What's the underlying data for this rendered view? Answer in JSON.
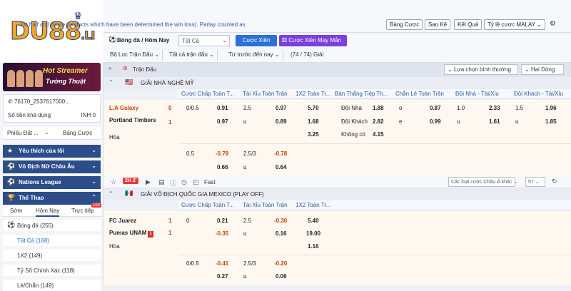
{
  "brand": {
    "logo_text": "DU88",
    "logo_suffix": ".LI",
    "crown_icon": "crown-icon",
    "primary_color": "#2c4d8a",
    "accent_color": "#f5a623"
  },
  "banner": {
    "title": "Hot Streamer",
    "subtitle": "Tướng Thuật"
  },
  "account": {
    "id": "76170_2537617000...",
    "balance_label": "Số tiền khả dụng",
    "balance_value": "INH 0"
  },
  "bet_tabs": {
    "slip": "Phiếu Đặt ...",
    "table": "Bảng Cược"
  },
  "sidebar": {
    "sections": [
      {
        "label": "Yêu thích của tôi",
        "icon": "star-icon"
      },
      {
        "label": "Vô Địch Nữ Châu Âu",
        "icon": "soccer-icon"
      },
      {
        "label": "Nations League",
        "icon": "soccer-icon"
      },
      {
        "label": "Thể Thao",
        "icon": "trophy-icon"
      }
    ],
    "sport_tabs": [
      "Sớm",
      "Hôm Nay",
      "Trực tiếp"
    ],
    "live_count": "103",
    "sport_rows": [
      {
        "label": "Bóng đá",
        "count": "(255)"
      },
      {
        "label": "Tất Cả",
        "count": "(168)"
      },
      {
        "label": "1X2",
        "count": "(149)"
      },
      {
        "label": "Tỷ Số Chính Xác",
        "count": "(118)"
      },
      {
        "label": "Lẻ/Chẵn",
        "count": "(149)"
      }
    ]
  },
  "header": {
    "notice": "1st half and those products which have been determined the win loss). Parlay counted as",
    "buttons": [
      "Bảng Cược",
      "Sao Kê",
      "Kết Quả",
      "Tỷ lệ cược MALAY"
    ]
  },
  "sportbar": {
    "title": "Bóng đá / Hôm Nay",
    "filter": "Tất Cả",
    "parlay": "Cược Xiên",
    "random_parlay": "Cược Xiên May Mắn"
  },
  "filters": {
    "league": "Bộ Lọc Trận Đấu",
    "all_matches": "Tất cả trận đấu",
    "sort": "Từ trước đến nay",
    "count": "(74 / 74)",
    "result": "Giải"
  },
  "market": {
    "title": "Trận Đấu",
    "sort_select": "Lựa chọn bình thường",
    "lines_select": "Hai Dòng"
  },
  "columns": [
    "Cược Chấp Toàn T...",
    "Tài Xỉu Toàn Trận",
    "1X2 Toàn Tr...",
    "Bàn Thắng Tiếp Th...",
    "Chẵn Lẻ Toàn Trận",
    "Đội Nhà - Tài/Xỉu",
    "Đội Khách - Tài/Xỉu"
  ],
  "columns2": [
    "Cược Chấp Toàn T...",
    "Tài Xỉu Toàn Trận",
    "1X2 Toàn Tr..."
  ],
  "league1": {
    "name": "GIẢI NHÀ NGHỀ MỸ",
    "home": "L.A Galaxy",
    "home_score": "0",
    "away": "Portland Timbers",
    "away_score": "1",
    "draw": "Hòa",
    "row1": {
      "hdp": "0/0.5",
      "hdp_odd": "0.91",
      "ou": "2.5",
      "ou_odd": "0.97",
      "x12": "5.70",
      "next_label": "Đội Nhà",
      "next_odd": "1.88",
      "oe": "o",
      "oe_odd": "0.87",
      "hou": "1.0",
      "hou_odd": "2.33",
      "aou": "1.5",
      "aou_odd": "1.96"
    },
    "row2": {
      "hdp_odd": "0.97",
      "ou": "u",
      "ou_odd": "0.89",
      "x12": "1.68",
      "next_label": "Đội Khách",
      "next_odd": "2.82",
      "oe": "e",
      "oe_odd": "0.99",
      "hou": "u",
      "hou_odd": "1.61",
      "aou": "u",
      "aou_odd": "1.85"
    },
    "row3": {
      "x12": "3.25",
      "next_label": "Không có",
      "next_odd": "4.15"
    },
    "alt1": {
      "hdp": "0.5",
      "hdp_odd": "-0.78",
      "ou": "2.5/3",
      "ou_odd": "-0.78"
    },
    "alt2": {
      "hdp_odd": "0.66",
      "ou": "u",
      "ou_odd": "0.64"
    }
  },
  "controls": {
    "live": "2H 2'",
    "fast": "Fast",
    "handicap_select": "Các loại cược Châu Á khác",
    "count_select": "57"
  },
  "league2": {
    "name": "GIẢI VÔ ĐỊCH QUỐC GIA MEXICO (PLAY OFF)",
    "home": "FC Juarez",
    "home_score": "1",
    "away": "Pumas UNAM",
    "away_red": "1",
    "away_score": "1",
    "draw": "Hòa",
    "row1": {
      "hdp": "0",
      "hdp_odd": "0.21",
      "ou": "2.5",
      "ou_odd": "-0.30",
      "x12": "5.40"
    },
    "row2": {
      "hdp_odd": "-0.35",
      "ou": "u",
      "ou_odd": "0.16",
      "x12": "19.00"
    },
    "row3": {
      "x12": "1.16"
    },
    "alt1": {
      "hdp": "0/0.5",
      "hdp_odd": "-0.41",
      "ou": "2.5/3",
      "ou_odd": "-0.20"
    },
    "alt2": {
      "hdp_odd": "0.27",
      "ou": "u",
      "ou_odd": "0.06"
    }
  }
}
